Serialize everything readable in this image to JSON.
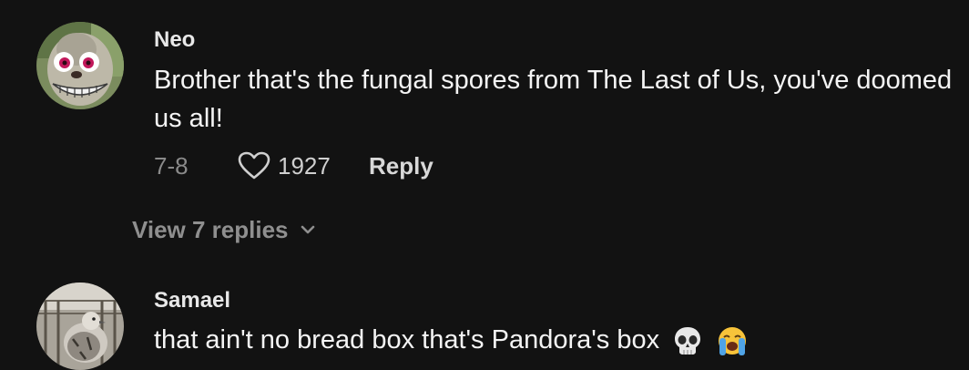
{
  "comments": [
    {
      "username": "Neo",
      "text": "Brother that's the fungal spores from The Last of Us, you've doomed us all!",
      "date": "7-8",
      "likes": "1927",
      "reply_label": "Reply",
      "view_replies_label": "View 7 replies",
      "avatar_icon": "cartoon-monster-avatar"
    },
    {
      "username": "Samael",
      "text": "that ain't no bread box that's Pandora's box",
      "emojis": [
        "skull-emoji",
        "loudly-crying-face-emoji"
      ],
      "avatar_icon": "pigeon-photo-avatar"
    }
  ],
  "colors": {
    "background": "#121212",
    "text": "#f4f4f4",
    "muted": "#8a8a8a"
  }
}
